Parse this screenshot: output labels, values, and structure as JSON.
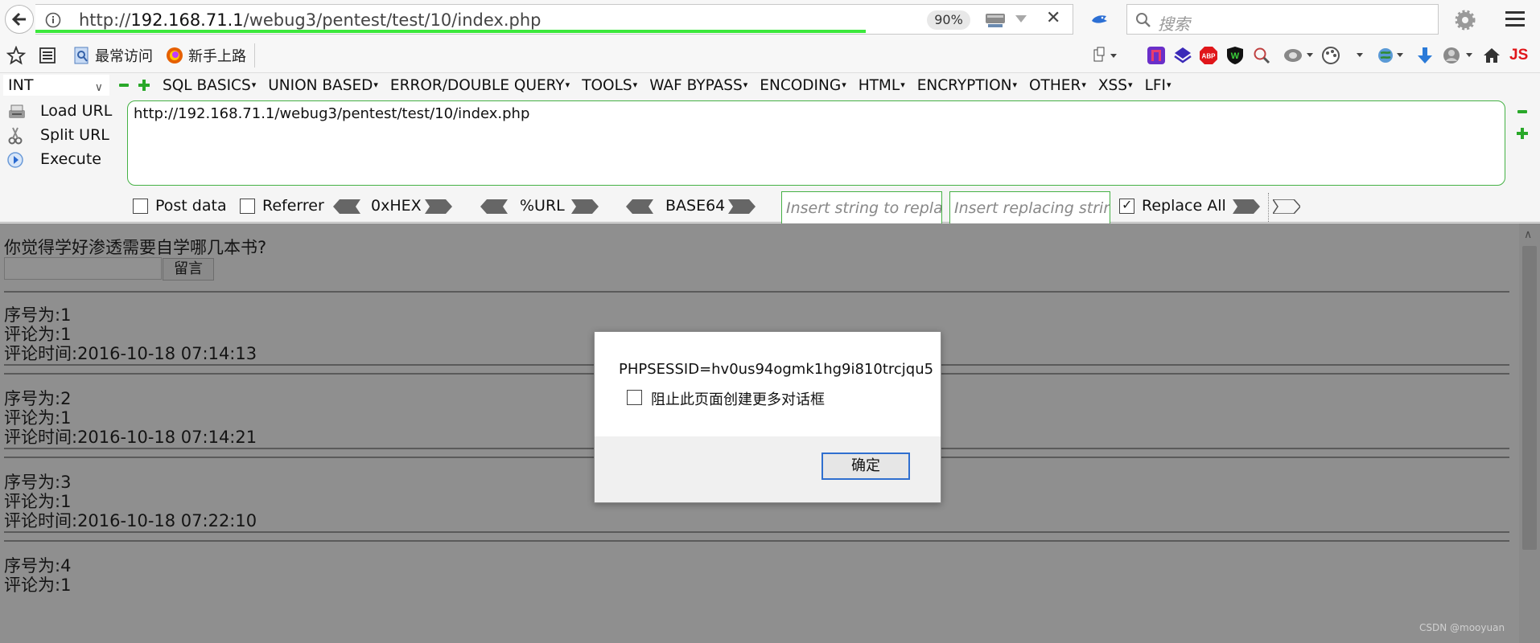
{
  "browser": {
    "url": "http://192.168.71.1/webug3/pentest/test/10/index.php",
    "url_prefix": "http://",
    "url_host": "192.168.71.1",
    "url_path": "/webug3/pentest/test/10/index.php",
    "zoom": "90%",
    "search_placeholder": "搜索",
    "load_progress": 0.8
  },
  "bookmarks": [
    {
      "label": "最常访问",
      "icon": "most-visited-icon"
    },
    {
      "label": "新手上路",
      "icon": "firefox-icon"
    }
  ],
  "toolbar_icons": [
    "page-menu-icon",
    "pocket-icon",
    "stylish-icon",
    "adblock-plus-icon",
    "web-of-trust-icon",
    "inspector-icon",
    "shield-icon",
    "palette-icon",
    "globe-icon",
    "download-icon",
    "avatar-icon",
    "home-icon",
    "js-icon"
  ],
  "hackbar": {
    "select_value": "INT",
    "menus": [
      "SQL BASICS",
      "UNION BASED",
      "ERROR/DOUBLE QUERY",
      "TOOLS",
      "WAF BYPASS",
      "ENCODING",
      "HTML",
      "ENCRYPTION",
      "OTHER",
      "XSS",
      "LFI"
    ],
    "load_url": "Load URL",
    "split_url": "Split URL",
    "execute": "Execute",
    "url_value": "http://192.168.71.1/webug3/pentest/test/10/index.php",
    "post_data": "Post data",
    "referrer": "Referrer",
    "hex": "0xHEX",
    "url_enc": "%URL",
    "base64": "BASE64",
    "replace_placeholder": "Insert string to replace",
    "replacing_placeholder": "Insert replacing string",
    "replace_all": "Replace All",
    "post_checked": false,
    "referrer_checked": false,
    "replace_all_checked": true
  },
  "page": {
    "question": "你觉得学好渗透需要自学哪几本书?",
    "submit_label": "留言",
    "comments": [
      {
        "id_line": "序号为:1",
        "content_line": "评论为:1",
        "time_line": "评论时间:2016-10-18 07:14:13"
      },
      {
        "id_line": "序号为:2",
        "content_line": "评论为:1",
        "time_line": "评论时间:2016-10-18 07:14:21"
      },
      {
        "id_line": "序号为:3",
        "content_line": "评论为:1",
        "time_line": "评论时间:2016-10-18 07:22:10"
      },
      {
        "id_line": "序号为:4",
        "content_line": "评论为:1",
        "time_line": ""
      }
    ],
    "watermark": "CSDN @mooyuan"
  },
  "dialog": {
    "message": "PHPSESSID=hv0us94ogmk1hg9i810trcjqu5",
    "checkbox_label": "阻止此页面创建更多对话框",
    "ok_label": "确定"
  },
  "colors": {
    "progress": "#3ce83c",
    "hackbar_border": "#45b145",
    "dialog_button_border": "#2f6fcf",
    "overlay": "#8f8f8f"
  }
}
